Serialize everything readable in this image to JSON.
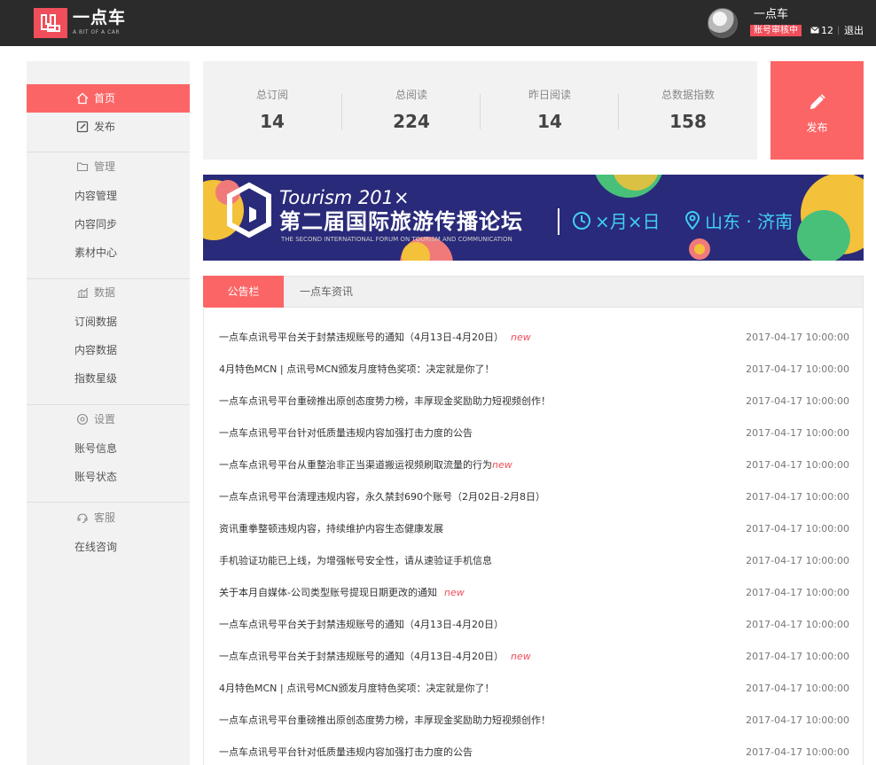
{
  "header": {
    "logo_text": "一点车",
    "logo_sub": "A BIT OF A CAR",
    "user_name": "一点车",
    "status_badge": "账号审核中",
    "mail_count": "12",
    "separator": "|",
    "logout": "退出"
  },
  "sidebar": {
    "home": "首页",
    "publish": "发布",
    "sections": [
      {
        "title": "管理",
        "icon": "folder-icon",
        "items": [
          "内容管理",
          "内容同步",
          "素材中心"
        ]
      },
      {
        "title": "数据",
        "icon": "chart-icon",
        "items": [
          "订阅数据",
          "内容数据",
          "指数星级"
        ]
      },
      {
        "title": "设置",
        "icon": "settings-icon",
        "items": [
          "账号信息",
          "账号状态"
        ]
      },
      {
        "title": "客服",
        "icon": "headset-icon",
        "items": [
          "在线咨询"
        ]
      }
    ]
  },
  "stats": [
    {
      "label": "总订阅",
      "value": "14"
    },
    {
      "label": "总阅读",
      "value": "224"
    },
    {
      "label": "昨日阅读",
      "value": "14"
    },
    {
      "label": "总数据指数",
      "value": "158"
    }
  ],
  "publish_button": "发布",
  "banner": {
    "title_en": "Tourism 201×",
    "title_cn": "第二届国际旅游传播论坛",
    "subtitle": "THE SECOND INTERNATIONAL FORUM ON TOURISM AND COMMUNICATION",
    "date": "×月×日",
    "location": "山东 · 济南"
  },
  "tabs": [
    "公告栏",
    "一点车资讯"
  ],
  "notices": [
    {
      "title": "一点车点讯号平台关于封禁违规账号的通知（4月13日-4月20日）",
      "new": "new",
      "date": "2017-04-17 10:00:00"
    },
    {
      "title": "4月特色MCN | 点讯号MCN颁发月度特色奖项：决定就是你了！",
      "new": "",
      "date": "2017-04-17 10:00:00"
    },
    {
      "title": "一点车点讯号平台重磅推出原创态度势力榜，丰厚现金奖励助力短视频创作！",
      "new": "",
      "date": "2017-04-17 10:00:00"
    },
    {
      "title": "一点车点讯号平台针对低质量违规内容加强打击力度的公告",
      "new": "",
      "date": "2017-04-17 10:00:00"
    },
    {
      "title": "一点车点讯号平台从重整治非正当渠道搬运视频刷取流量的行为",
      "new": "new",
      "tight": true,
      "date": "2017-04-17 10:00:00"
    },
    {
      "title": "一点车点讯号平台清理违规内容，永久禁封690个账号（2月02日-2月8日）",
      "new": "",
      "date": "2017-04-17 10:00:00"
    },
    {
      "title": "资讯重拳整顿违规内容，持续维护内容生态健康发展",
      "new": "",
      "date": "2017-04-17 10:00:00"
    },
    {
      "title": "手机验证功能已上线，为增强帐号安全性，请从速验证手机信息",
      "new": "",
      "date": "2017-04-17 10:00:00"
    },
    {
      "title": "关于本月自媒体-公司类型账号提现日期更改的通知",
      "new": "new",
      "date": "2017-04-17 10:00:00"
    },
    {
      "title": "一点车点讯号平台关于封禁违规账号的通知（4月13日-4月20日）",
      "new": "",
      "date": "2017-04-17 10:00:00"
    },
    {
      "title": "一点车点讯号平台关于封禁违规账号的通知（4月13日-4月20日）",
      "new": "new",
      "date": "2017-04-17 10:00:00"
    },
    {
      "title": "4月特色MCN | 点讯号MCN颁发月度特色奖项：决定就是你了！",
      "new": "",
      "date": "2017-04-17 10:00:00"
    },
    {
      "title": "一点车点讯号平台重磅推出原创态度势力榜，丰厚现金奖励助力短视频创作！",
      "new": "",
      "date": "2017-04-17 10:00:00"
    },
    {
      "title": "一点车点讯号平台针对低质量违规内容加强打击力度的公告",
      "new": "",
      "date": "2017-04-17 10:00:00"
    }
  ],
  "colors": {
    "accent": "#fc6566",
    "header_bg": "#2b2b2b",
    "banner_bg": "#2a2a7a",
    "banner_text": "#3fd0f0"
  }
}
